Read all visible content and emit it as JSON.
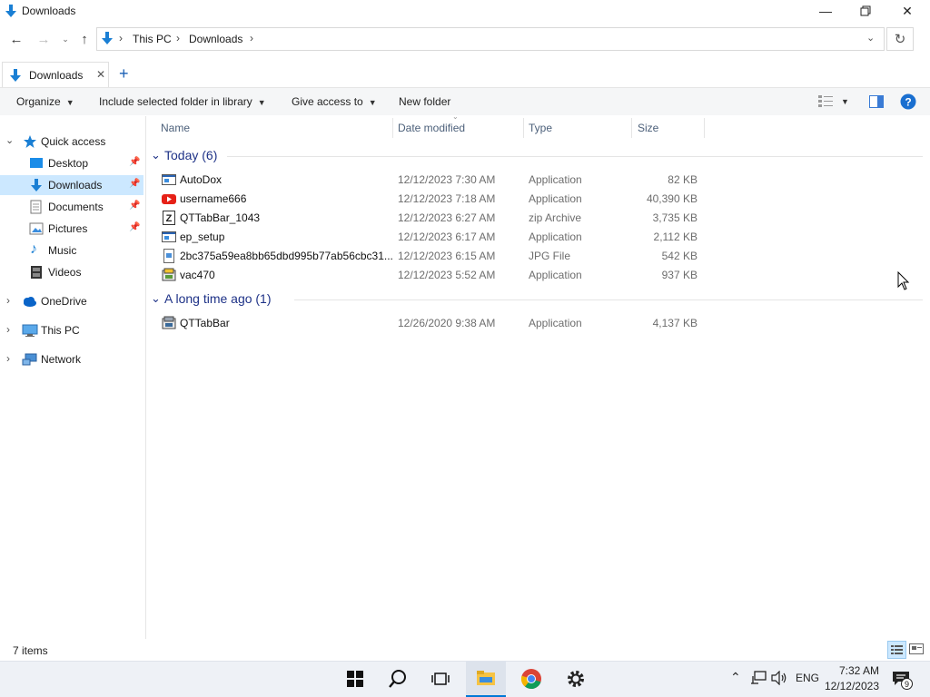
{
  "window": {
    "title": "Downloads"
  },
  "address": {
    "crumbs": [
      "This PC",
      "Downloads"
    ]
  },
  "tabs": [
    {
      "label": "Downloads"
    }
  ],
  "toolbar": {
    "organize": "Organize",
    "include_library": "Include selected folder in library",
    "give_access": "Give access to",
    "new_folder": "New folder"
  },
  "nav": {
    "quick_access": "Quick access",
    "pinned": [
      "Desktop",
      "Downloads",
      "Documents",
      "Pictures"
    ],
    "unpinned": [
      "Music",
      "Videos"
    ],
    "onedrive": "OneDrive",
    "this_pc": "This PC",
    "network": "Network"
  },
  "columns": {
    "name": "Name",
    "date": "Date modified",
    "type": "Type",
    "size": "Size"
  },
  "groups": [
    {
      "label": "Today (6)",
      "files": [
        {
          "name": "AutoDox",
          "date": "12/12/2023 7:30 AM",
          "type": "Application",
          "size": "82 KB",
          "icon": "application-icon"
        },
        {
          "name": "username666",
          "date": "12/12/2023 7:18 AM",
          "type": "Application",
          "size": "40,390 KB",
          "icon": "youtube-icon"
        },
        {
          "name": "QTTabBar_1043",
          "date": "12/12/2023 6:27 AM",
          "type": "zip Archive",
          "size": "3,735 KB",
          "icon": "zip-icon"
        },
        {
          "name": "ep_setup",
          "date": "12/12/2023 6:17 AM",
          "type": "Application",
          "size": "2,112 KB",
          "icon": "application-icon"
        },
        {
          "name": "2bc375a59ea8bb65dbd995b77ab56cbc31...",
          "date": "12/12/2023 6:15 AM",
          "type": "JPG File",
          "size": "542 KB",
          "icon": "image-file-icon"
        },
        {
          "name": "vac470",
          "date": "12/12/2023 5:52 AM",
          "type": "Application",
          "size": "937 KB",
          "icon": "installer-icon"
        }
      ]
    },
    {
      "label": "A long time ago (1)",
      "files": [
        {
          "name": "QTTabBar",
          "date": "12/26/2020 9:38 AM",
          "type": "Application",
          "size": "4,137 KB",
          "icon": "installer-icon"
        }
      ]
    }
  ],
  "status": {
    "items": "7 items"
  },
  "tray": {
    "lang": "ENG",
    "time": "7:32 AM",
    "date": "12/12/2023",
    "notifications": "9"
  },
  "colors": {
    "accent": "#0078d7",
    "selection": "#cce8ff",
    "group": "#1e3287",
    "folder_blue": "#1a7fd4"
  }
}
